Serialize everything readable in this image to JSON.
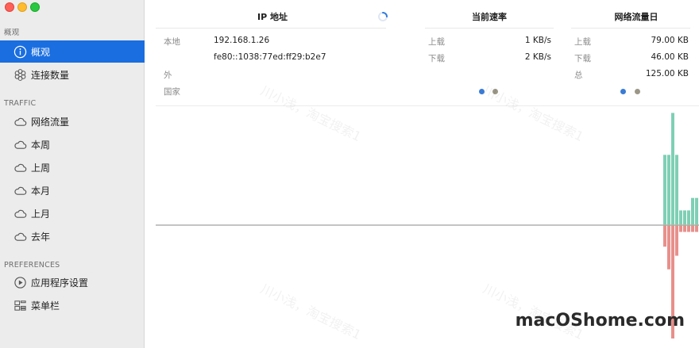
{
  "sidebar": {
    "sections": [
      {
        "header": "概观",
        "items": [
          {
            "label": "概观",
            "icon": "info-icon",
            "active": true
          },
          {
            "label": "连接数量",
            "icon": "flower-icon",
            "active": false
          }
        ]
      },
      {
        "header": "TRAFFIC",
        "items": [
          {
            "label": "网络流量",
            "icon": "cloud-icon",
            "active": false
          },
          {
            "label": "本周",
            "icon": "cloud-icon",
            "active": false
          },
          {
            "label": "上周",
            "icon": "cloud-icon",
            "active": false
          },
          {
            "label": "本月",
            "icon": "cloud-icon",
            "active": false
          },
          {
            "label": "上月",
            "icon": "cloud-icon",
            "active": false
          },
          {
            "label": "去年",
            "icon": "cloud-icon",
            "active": false
          }
        ]
      },
      {
        "header": "PREFERENCES",
        "items": [
          {
            "label": "应用程序设置",
            "icon": "play-circle-icon",
            "active": false
          },
          {
            "label": "菜单栏",
            "icon": "menubar-icon",
            "active": false
          }
        ]
      }
    ]
  },
  "ip_panel": {
    "title": "IP 地址",
    "local_label": "本地",
    "ipv4": "192.168.1.26",
    "ipv6": "fe80::1038:77ed:ff29:b2e7",
    "external_label": "外",
    "country_label": "国家"
  },
  "speed_panel": {
    "title": "当前速率",
    "upload_label": "上载",
    "upload_value": "1 KB/s",
    "download_label": "下载",
    "download_value": "2 KB/s"
  },
  "daily_panel": {
    "title": "网络流量日",
    "upload_label": "上载",
    "upload_value": "79.00 KB",
    "download_label": "下载",
    "download_value": "46.00 KB",
    "total_label": "总",
    "total_value": "125.00 KB"
  },
  "colors": {
    "accent": "#1a6ee0",
    "upload": "#7fcfb5",
    "download": "#e8908c",
    "dot_blue": "#3a7bd5",
    "dot_gray": "#9b9787"
  },
  "chart_data": {
    "type": "bar",
    "series": [
      {
        "values": [
          0.62,
          0.62,
          0.99,
          0.62,
          0.13,
          0.13,
          0.13,
          0.24,
          0.24
        ]
      },
      {
        "values": [
          -0.19,
          -0.39,
          -1.0,
          -0.27,
          -0.06,
          -0.06,
          -0.06,
          -0.06,
          -0.06
        ]
      }
    ]
  },
  "watermark": "川小浅，淘宝搜索1",
  "brand": "macOShome.com"
}
